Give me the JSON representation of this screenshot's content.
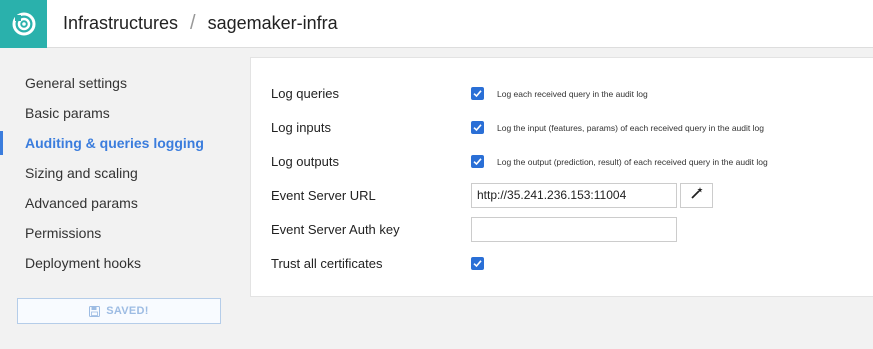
{
  "header": {
    "breadcrumb_root": "Infrastructures",
    "separator": "/",
    "breadcrumb_current": "sagemaker-infra",
    "logo_icon": "dataiku-logo-icon",
    "brand_color": "#2ab1ac"
  },
  "sidebar": {
    "items": [
      {
        "label": "General settings",
        "active": false
      },
      {
        "label": "Basic params",
        "active": false
      },
      {
        "label": "Auditing & queries logging",
        "active": true
      },
      {
        "label": "Sizing and scaling",
        "active": false
      },
      {
        "label": "Advanced params",
        "active": false
      },
      {
        "label": "Permissions",
        "active": false
      },
      {
        "label": "Deployment hooks",
        "active": false
      }
    ],
    "save_button": {
      "label": "SAVED!",
      "icon": "floppy-disk-icon"
    },
    "accent_color": "#3b7ddd"
  },
  "form": {
    "log_queries": {
      "label": "Log queries",
      "checked": true,
      "help": "Log each received query in the audit log"
    },
    "log_inputs": {
      "label": "Log inputs",
      "checked": true,
      "help": "Log the input (features, params) of each received query in the audit log"
    },
    "log_outputs": {
      "label": "Log outputs",
      "checked": true,
      "help": "Log the output (prediction, result) of each received query in the audit log"
    },
    "event_server_url": {
      "label": "Event Server URL",
      "value": "http://35.241.236.153:11004",
      "button_icon": "magic-wand-icon"
    },
    "event_server_auth_key": {
      "label": "Event Server Auth key",
      "value": ""
    },
    "trust_all_certificates": {
      "label": "Trust all certificates",
      "checked": true
    }
  }
}
